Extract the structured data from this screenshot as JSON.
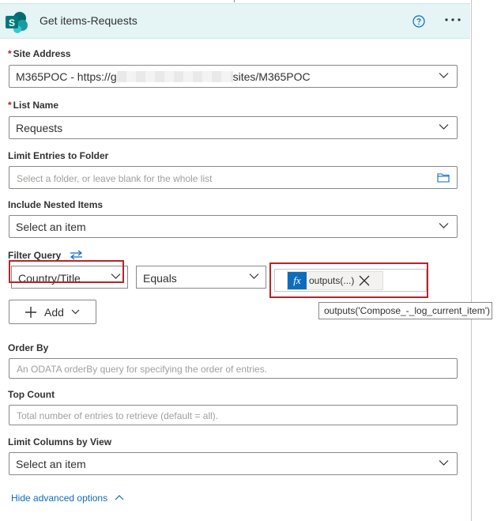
{
  "header": {
    "title": "Get items-Requests",
    "logo_letter": "S"
  },
  "site_address": {
    "label": "Site Address",
    "value_prefix": "M365POC - https://g",
    "value_suffix": "sites/M365POC"
  },
  "list_name": {
    "label": "List Name",
    "value": "Requests"
  },
  "folder": {
    "label": "Limit Entries to Folder",
    "placeholder": "Select a folder, or leave blank for the whole list"
  },
  "nested": {
    "label": "Include Nested Items",
    "value": "Select an item"
  },
  "filter_query": {
    "label": "Filter Query",
    "field": "Country/Title",
    "operator": "Equals",
    "token_text": "outputs(...)",
    "token_icon": "fx",
    "tooltip": "outputs('Compose_-_log_current_item')",
    "add_label": "Add"
  },
  "order_by": {
    "label": "Order By",
    "placeholder": "An ODATA orderBy query for specifying the order of entries."
  },
  "top_count": {
    "label": "Top Count",
    "placeholder": "Total number of entries to retrieve (default = all)."
  },
  "columns_view": {
    "label": "Limit Columns by View",
    "value": "Select an item"
  },
  "footer": {
    "advanced_label": "Hide advanced options"
  },
  "required_marker": "*",
  "colors": {
    "header_bg": "#e5f4f4",
    "accent": "#0f6cbd",
    "highlight": "#b8232a",
    "sharepoint": "#036c70"
  }
}
